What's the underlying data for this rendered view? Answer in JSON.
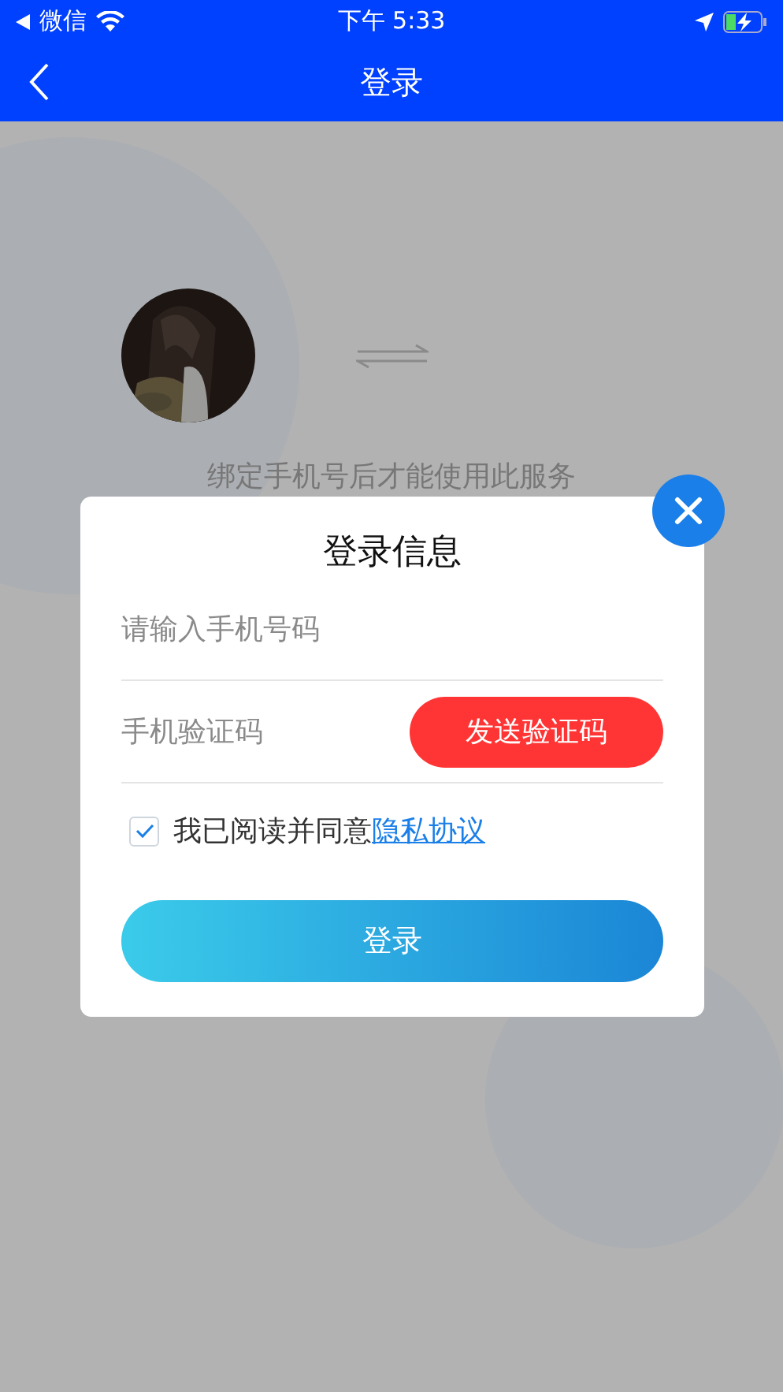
{
  "status_bar": {
    "back_app": "微信",
    "time": "下午 5:33"
  },
  "nav": {
    "title": "登录"
  },
  "bind_notice": "绑定手机号后才能使用此服务",
  "dialog": {
    "title": "登录信息",
    "phone_field": {
      "placeholder": "请输入手机号码"
    },
    "code_field": {
      "placeholder": "手机验证码"
    },
    "send_code_button": "发送验证码",
    "agreement": {
      "checked": true,
      "text": "我已阅读并同意",
      "link": "隐私协议"
    },
    "login_button": "登录"
  }
}
